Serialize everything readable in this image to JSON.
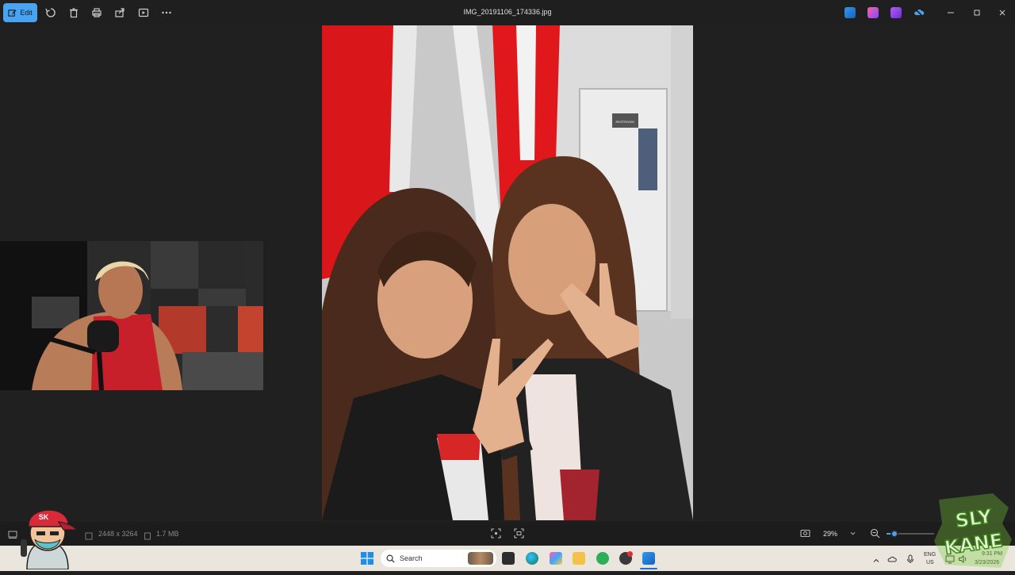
{
  "toolbar": {
    "edit_label": "Edit",
    "file_title": "IMG_20191106_174336.jpg"
  },
  "status": {
    "dimensions": "2448 x 3264",
    "file_size": "1.7 MB",
    "zoom": "29%",
    "zoom_fraction": 0.29
  },
  "taskbar": {
    "search_placeholder": "Search",
    "lang_top": "ENG",
    "lang_bottom": "US",
    "time": "9:31 PM",
    "date": "3/23/2026"
  },
  "overlay": {
    "logo_text_1": "SLY",
    "logo_text_2": "KANE",
    "avatar_badge": "SK"
  },
  "photo": {
    "sign_text": "RESTROOM"
  },
  "colors": {
    "accent": "#4aa3f0",
    "titlebar": "#1f1f1f",
    "taskbar": "#eae6de",
    "sign_red": "#e0181c"
  }
}
